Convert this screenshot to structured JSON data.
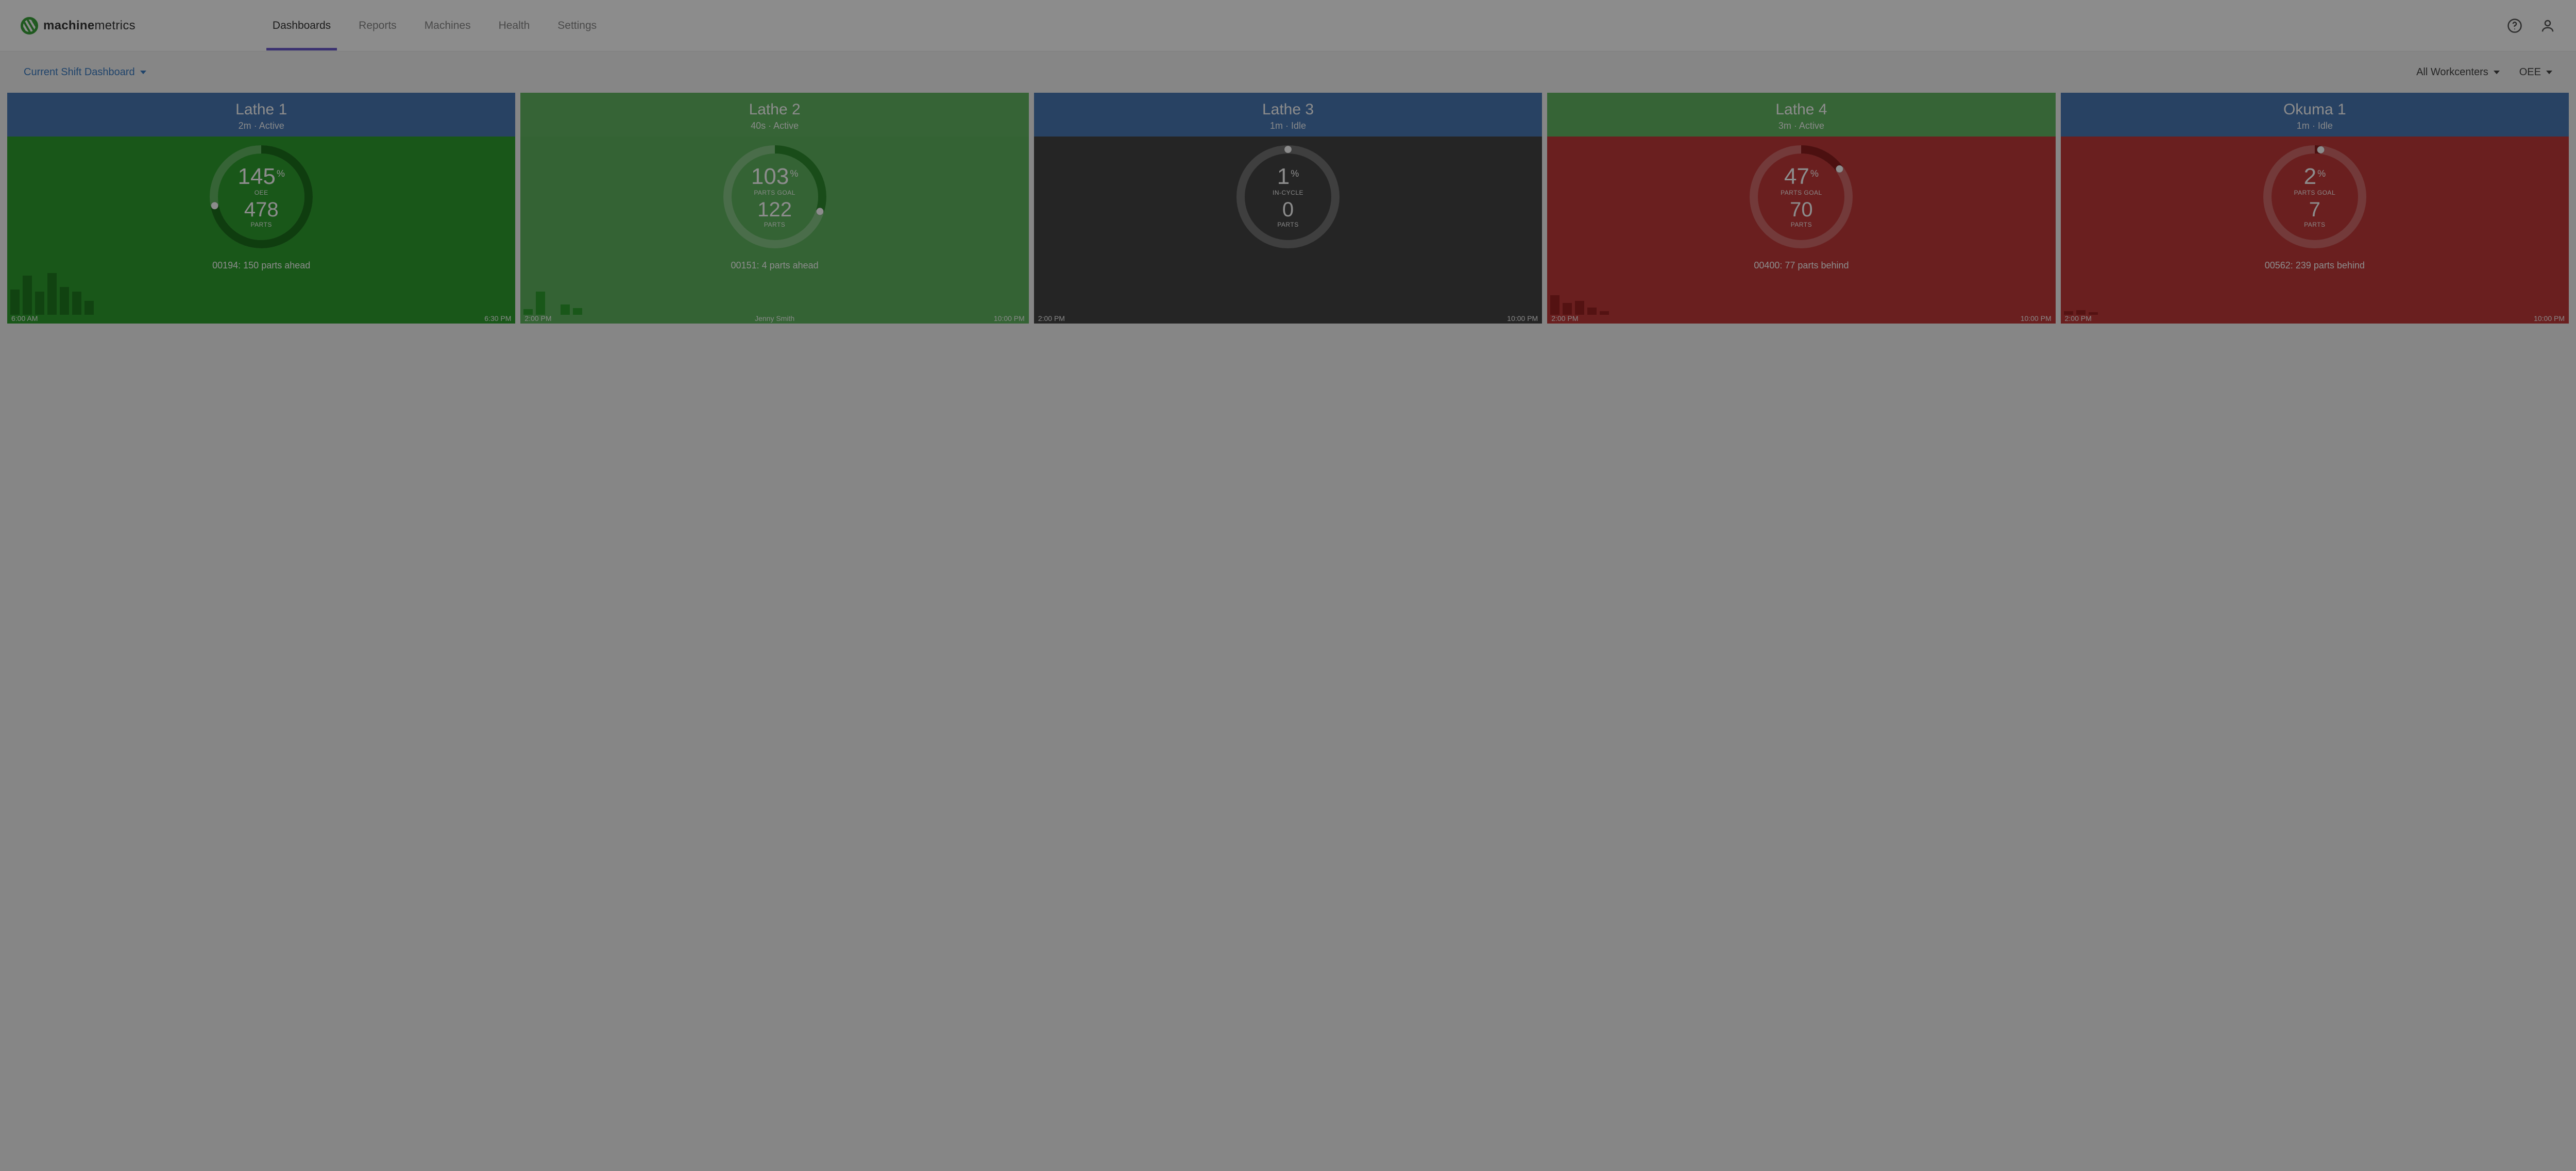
{
  "brand": {
    "name_bold": "machine",
    "name_light": "metrics"
  },
  "nav": {
    "items": [
      "Dashboards",
      "Reports",
      "Machines",
      "Health",
      "Settings"
    ],
    "active_index": 0
  },
  "filters": {
    "dashboard_selector": "Current Shift Dashboard",
    "workcenter_selector": "All Workcenters",
    "metric_selector": "OEE"
  },
  "colors": {
    "hdr_blue": "#4a78b5",
    "hdr_green": "#63b763",
    "body_green": "#2f9e2f",
    "body_green_light": "#5fb55f",
    "body_grey": "#444444",
    "body_red": "#c23a3a"
  },
  "cards": [
    {
      "name": "Lathe 1",
      "duration": "2m",
      "state": "Active",
      "header_color": "hdr-blue",
      "body_color": "body-green",
      "pct": "145",
      "pct_label": "OEE",
      "parts": "478",
      "parts_label": "PARTS",
      "gauge_fraction": 0.72,
      "gauge_stroke": "#1c6f1c",
      "status": "00194: 150 parts ahead",
      "bars": [
        55,
        85,
        50,
        90,
        60,
        50,
        30
      ],
      "bar_class": "bar-green",
      "time_start": "6:00 AM",
      "time_mid": "",
      "time_end": "6:30 PM"
    },
    {
      "name": "Lathe 2",
      "duration": "40s",
      "state": "Active",
      "header_color": "hdr-green",
      "body_color": "body-green-light",
      "pct": "103",
      "pct_label": "PARTS GOAL",
      "parts": "122",
      "parts_label": "PARTS",
      "gauge_fraction": 0.3,
      "gauge_stroke": "#2f8a2f",
      "status": "00151: 4 parts ahead",
      "bars": [
        12,
        50,
        0,
        22,
        14
      ],
      "bar_class": "bar-green-l",
      "time_start": "2:00 PM",
      "time_mid": "Jenny Smith",
      "time_end": "10:00 PM"
    },
    {
      "name": "Lathe 3",
      "duration": "1m",
      "state": "Idle",
      "header_color": "hdr-blue",
      "body_color": "body-grey",
      "pct": "1",
      "pct_label": "IN-CYCLE",
      "parts": "0",
      "parts_label": "PARTS",
      "gauge_fraction": 0.0,
      "gauge_stroke": "#222222",
      "status": "",
      "bars": [],
      "bar_class": "",
      "time_start": "2:00 PM",
      "time_mid": "",
      "time_end": "10:00 PM"
    },
    {
      "name": "Lathe 4",
      "duration": "3m",
      "state": "Active",
      "header_color": "hdr-green",
      "body_color": "body-red",
      "pct": "47",
      "pct_label": "PARTS GOAL",
      "parts": "70",
      "parts_label": "PARTS",
      "gauge_fraction": 0.15,
      "gauge_stroke": "#8a1e1e",
      "status": "00400: 77 parts behind",
      "bars": [
        42,
        26,
        30,
        16,
        8
      ],
      "bar_class": "bar-red",
      "time_start": "2:00 PM",
      "time_mid": "",
      "time_end": "10:00 PM"
    },
    {
      "name": "Okuma 1",
      "duration": "1m",
      "state": "Idle",
      "header_color": "hdr-blue",
      "body_color": "body-red",
      "pct": "2",
      "pct_label": "PARTS GOAL",
      "parts": "7",
      "parts_label": "PARTS",
      "gauge_fraction": 0.02,
      "gauge_stroke": "#8a1e1e",
      "status": "00562: 239 parts behind",
      "bars": [
        8,
        10,
        6
      ],
      "bar_class": "bar-red",
      "time_start": "2:00 PM",
      "time_mid": "",
      "time_end": "10:00 PM"
    }
  ],
  "chart_data": [
    {
      "type": "bar",
      "title": "Lathe 1 hourly parts",
      "xlabel": "",
      "ylabel": "parts",
      "categories": [
        "6:00 AM",
        "",
        "",
        "",
        "",
        "",
        "6:30 PM"
      ],
      "values": [
        55,
        85,
        50,
        90,
        60,
        50,
        30
      ],
      "ylim": [
        0,
        100
      ]
    },
    {
      "type": "bar",
      "title": "Lathe 2 hourly parts",
      "xlabel": "",
      "ylabel": "parts",
      "categories": [
        "2:00 PM",
        "",
        "",
        "",
        "10:00 PM"
      ],
      "values": [
        12,
        50,
        0,
        22,
        14
      ],
      "ylim": [
        0,
        100
      ],
      "annotation": "Jenny Smith"
    },
    {
      "type": "bar",
      "title": "Lathe 3 hourly parts",
      "xlabel": "",
      "ylabel": "parts",
      "categories": [
        "2:00 PM",
        "10:00 PM"
      ],
      "values": [],
      "ylim": [
        0,
        100
      ]
    },
    {
      "type": "bar",
      "title": "Lathe 4 hourly parts",
      "xlabel": "",
      "ylabel": "parts",
      "categories": [
        "2:00 PM",
        "",
        "",
        "",
        "10:00 PM"
      ],
      "values": [
        42,
        26,
        30,
        16,
        8
      ],
      "ylim": [
        0,
        100
      ]
    },
    {
      "type": "bar",
      "title": "Okuma 1 hourly parts",
      "xlabel": "",
      "ylabel": "parts",
      "categories": [
        "2:00 PM",
        "",
        "10:00 PM"
      ],
      "values": [
        8,
        10,
        6
      ],
      "ylim": [
        0,
        100
      ]
    }
  ]
}
